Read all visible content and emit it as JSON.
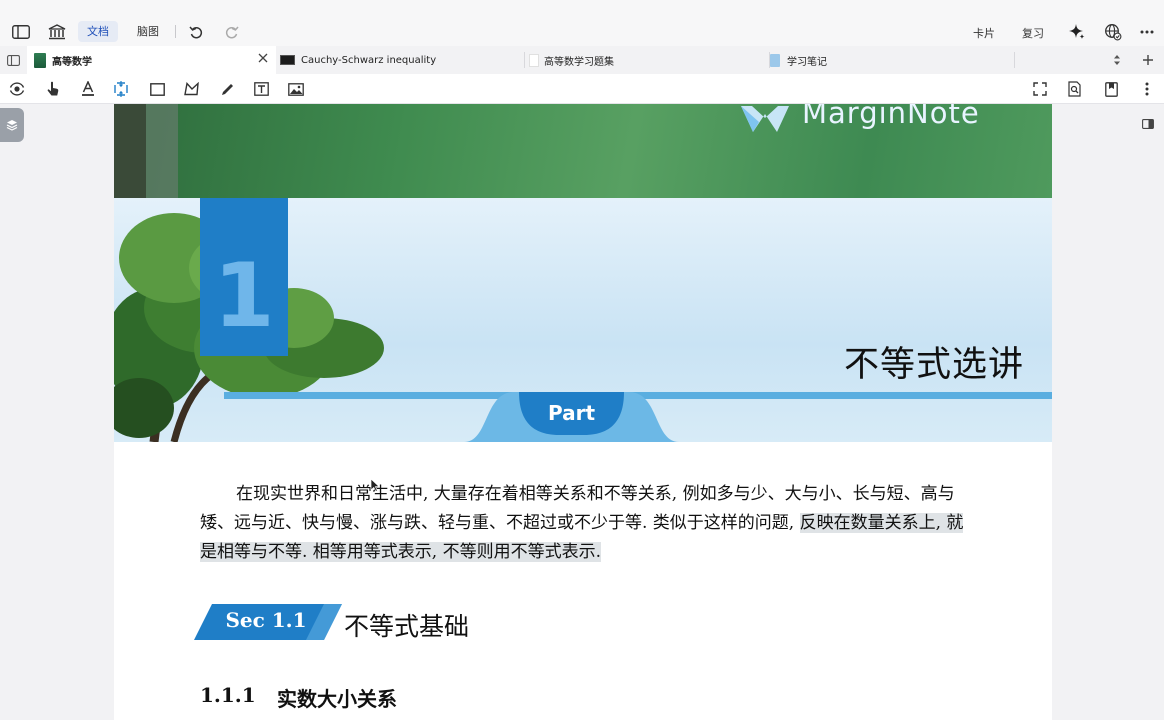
{
  "topbar": {
    "mode_tabs": [
      "文档",
      "脑图"
    ],
    "right_labels": [
      "卡片",
      "复习"
    ]
  },
  "tabs": [
    {
      "label": "高等数学",
      "active": true
    },
    {
      "label": "Cauchy-Schwarz inequality",
      "active": false
    },
    {
      "label": "高等数学习题集",
      "active": false
    },
    {
      "label": "学习笔记",
      "active": false
    }
  ],
  "page": {
    "banner_logo_text": "MarginNote",
    "chapter_number": "1",
    "chapter_title": "不等式选讲",
    "part_label": "Part",
    "paragraph_plain": "在现实世界和日常生活中, 大量存在着相等关系和不等关系, 例如多与少、大与小、长与短、高与矮、远与近、快与慢、涨与跌、轻与重、不超过或不少于等. 类似于这样的问题, ",
    "paragraph_highlight": "反映在数量关系上, 就是相等与不等. 相等用等式表示, 不等则用不等式表示.",
    "section_badge": "Sec 1.1",
    "section_title": "不等式基础",
    "subsection_number": "1.1.1",
    "subsection_title": "实数大小关系"
  },
  "colors": {
    "accent_blue": "#1f7ec7",
    "band_blue": "#cfe6f5",
    "banner_green": "#3b8a4e",
    "highlight": "#dfe3e6"
  }
}
